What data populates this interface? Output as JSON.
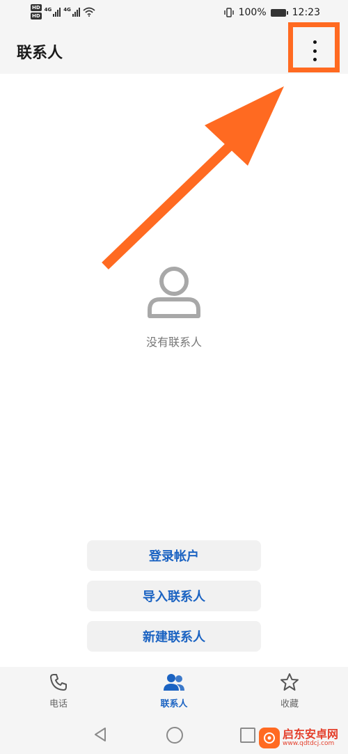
{
  "status_bar": {
    "hd_badge_1": "HD",
    "hd_badge_2": "HD",
    "network_1": "4G",
    "network_2": "4G",
    "battery_percent": "100%",
    "time": "12:23"
  },
  "app_bar": {
    "title": "联系人",
    "more_icon": "more-vertical-icon"
  },
  "empty_state": {
    "icon": "person-icon",
    "message": "没有联系人"
  },
  "actions": {
    "login": "登录帐户",
    "import": "导入联系人",
    "create": "新建联系人"
  },
  "tabs": [
    {
      "label": "电话",
      "icon": "phone-icon",
      "active": false
    },
    {
      "label": "联系人",
      "icon": "contacts-icon",
      "active": true
    },
    {
      "label": "收藏",
      "icon": "star-icon",
      "active": false
    }
  ],
  "watermark": {
    "name": "启东安卓网",
    "url": "www.qdtdcj.com"
  },
  "colors": {
    "accent": "#1b63c2",
    "highlight": "#ff6a21",
    "background": "#ffffff",
    "bar": "#f5f5f5"
  }
}
